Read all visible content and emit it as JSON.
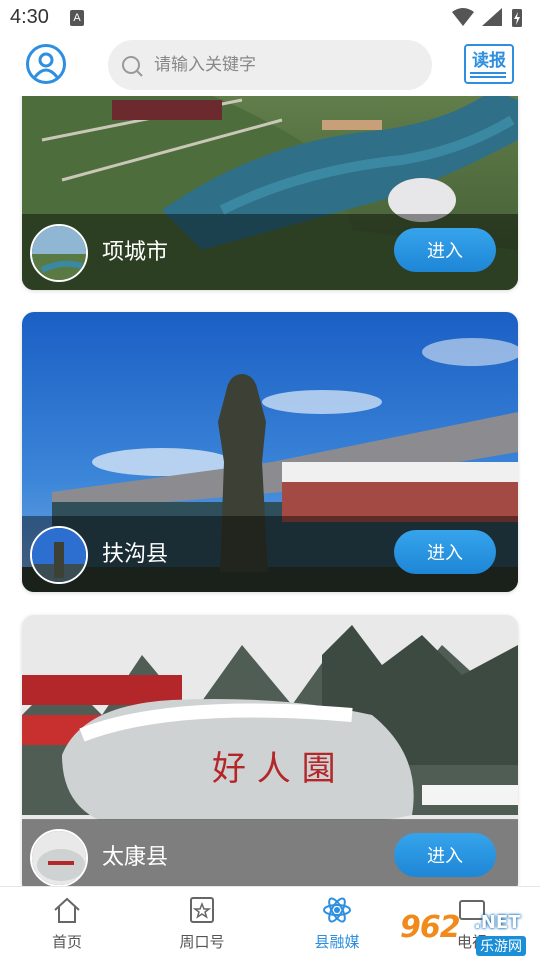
{
  "status_bar": {
    "time": "4:30",
    "notification_letter": "A"
  },
  "header": {
    "search_placeholder": "请输入关键字",
    "report_label": "读报"
  },
  "cards": [
    {
      "name": "项城市",
      "button_label": "进入"
    },
    {
      "name": "扶沟县",
      "button_label": "进入"
    },
    {
      "name": "太康县",
      "button_label": "进入"
    }
  ],
  "tabbar": {
    "tabs": [
      {
        "label": "首页",
        "icon": "home-icon"
      },
      {
        "label": "周口号",
        "icon": "star-badge-icon"
      },
      {
        "label": "县融媒",
        "icon": "atom-icon"
      },
      {
        "label": "电视",
        "icon": "tv-icon"
      }
    ],
    "active_index": 2
  },
  "watermark": {
    "logo": "962",
    "domain": ".NET",
    "site": "乐游网"
  },
  "colors": {
    "accent": "#2e8fe0",
    "button": "#1e86d6",
    "watermark": "#f08a1a"
  }
}
